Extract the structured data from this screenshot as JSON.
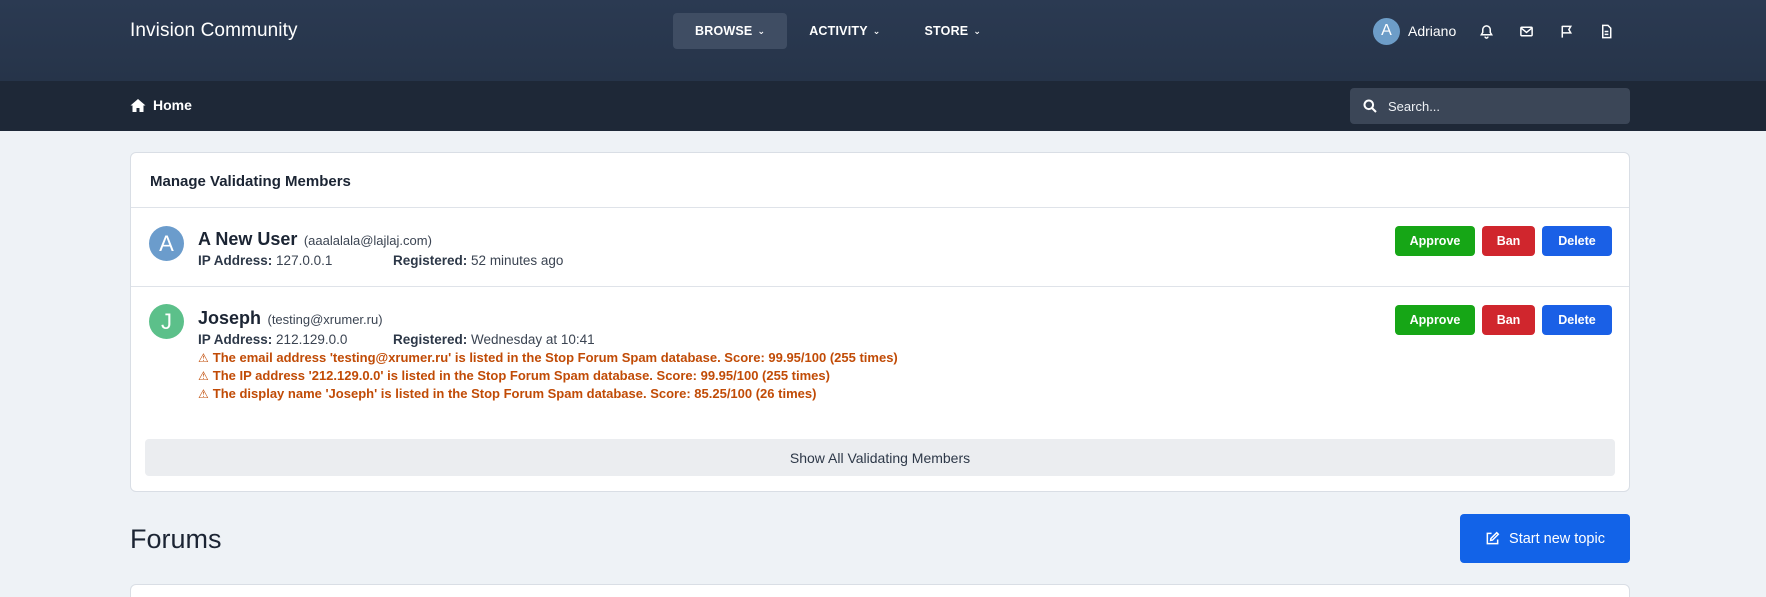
{
  "header": {
    "brand": "Invision Community",
    "nav": [
      {
        "label": "BROWSE",
        "active": true
      },
      {
        "label": "ACTIVITY",
        "active": false
      },
      {
        "label": "STORE",
        "active": false
      }
    ],
    "user": {
      "initial": "A",
      "name": "Adriano"
    },
    "icons": [
      "bell-icon",
      "envelope-icon",
      "flag-icon",
      "document-icon"
    ]
  },
  "subheader": {
    "home_label": "Home",
    "search_placeholder": "Search..."
  },
  "panel": {
    "title": "Manage Validating Members",
    "members": [
      {
        "initial": "A",
        "name": "A New User",
        "email": "(aaalalala@lajlaj.com)",
        "ip_label": "IP Address:",
        "ip": "127.0.0.1",
        "registered_label": "Registered:",
        "registered": "52 minutes ago",
        "warnings": [],
        "avatar_color": "#6b9ccc"
      },
      {
        "initial": "J",
        "name": "Joseph",
        "email": "(testing@xrumer.ru)",
        "ip_label": "IP Address:",
        "ip": "212.129.0.0",
        "registered_label": "Registered:",
        "registered": "Wednesday at 10:41",
        "warnings": [
          "The email address 'testing@xrumer.ru' is listed in the Stop Forum Spam database. Score: 99.95/100 (255 times)",
          "The IP address '212.129.0.0' is listed in the Stop Forum Spam database. Score: 99.95/100 (255 times)",
          "The display name 'Joseph' is listed in the Stop Forum Spam database. Score: 85.25/100 (26 times)"
        ],
        "avatar_color": "#5cc08a"
      }
    ],
    "actions": {
      "approve": "Approve",
      "ban": "Ban",
      "delete": "Delete"
    },
    "show_all": "Show All Validating Members"
  },
  "forums": {
    "title": "Forums",
    "start_topic": "Start new topic"
  },
  "colors": {
    "header_bg": "#2b3a52",
    "subheader_bg": "#1e2837",
    "approve": "#16a616",
    "ban": "#d0262d",
    "delete": "#1a60e6",
    "warning": "#c14b06"
  }
}
